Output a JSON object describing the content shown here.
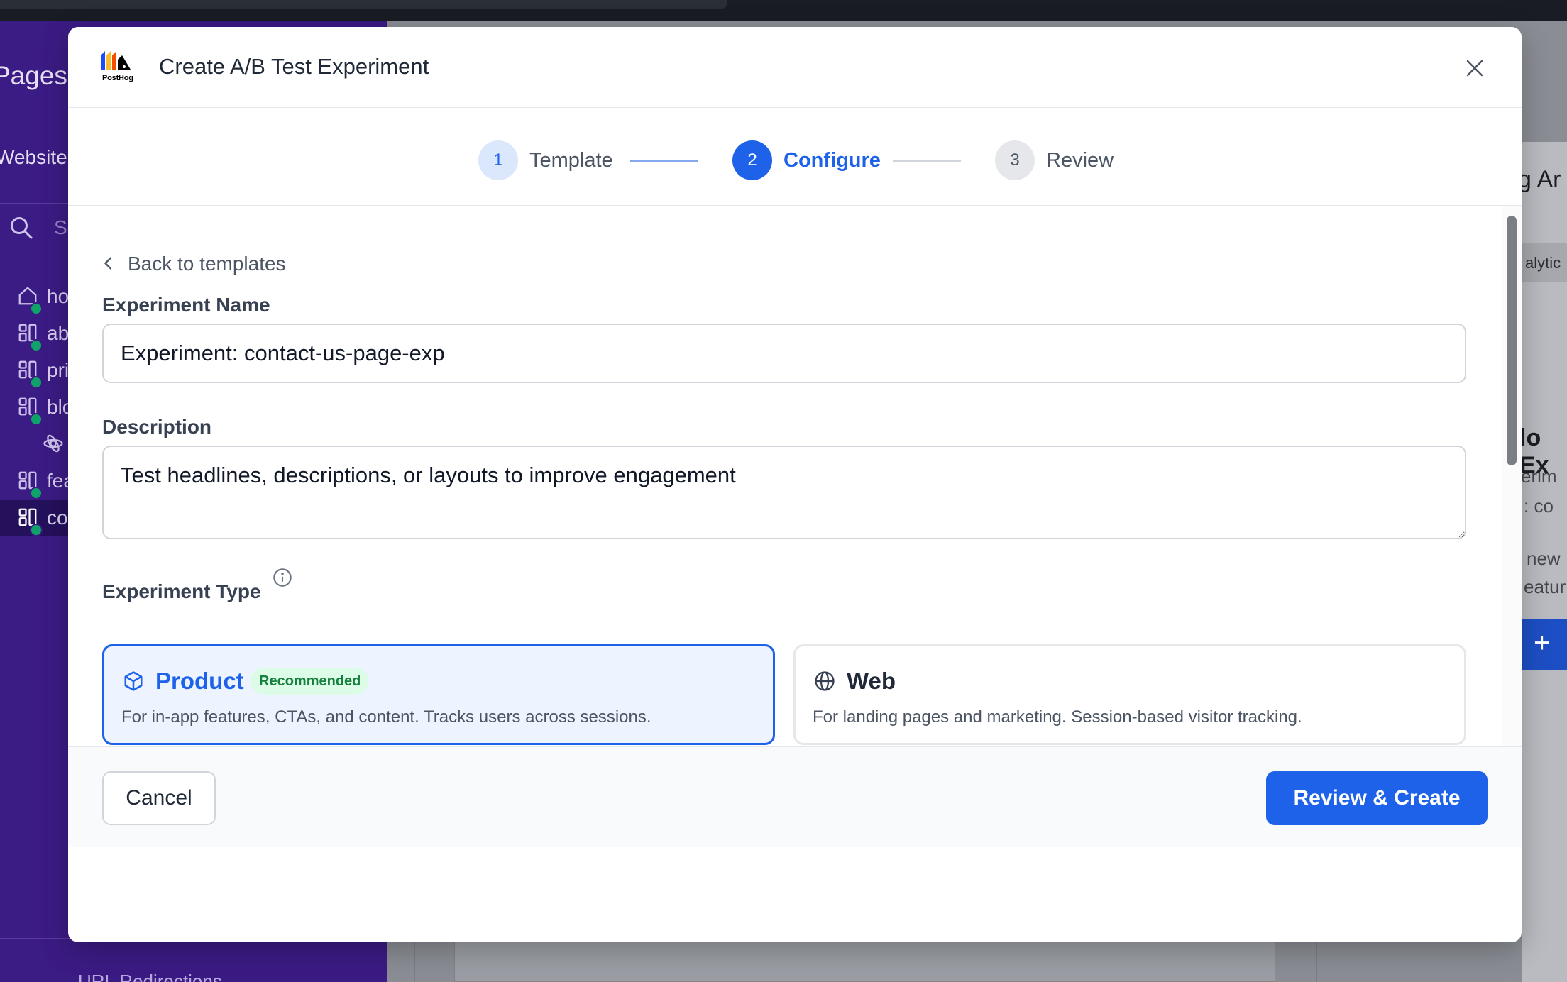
{
  "background": {
    "sidebar": {
      "title": "Pages",
      "subtitle": "Website",
      "search_placeholder": "Se",
      "items": [
        {
          "label": "ho",
          "icon": "home-icon"
        },
        {
          "label": "ab",
          "icon": "layout-icon"
        },
        {
          "label": "pri",
          "icon": "layout-icon"
        },
        {
          "label": "blo",
          "icon": "layout-icon"
        },
        {
          "label": "",
          "icon": "component-icon"
        },
        {
          "label": "fea",
          "icon": "layout-icon"
        },
        {
          "label": "co",
          "icon": "layout-icon"
        }
      ],
      "footer_link": "URL Redirections"
    },
    "right_panel": {
      "heading": "g Ar",
      "chip": "alytic",
      "empty_title": "lo Ex",
      "line1": "erim",
      "line2": ": co",
      "line3": "new",
      "line4": "eatur",
      "button": "+"
    }
  },
  "modal": {
    "logo_text": "PostHog",
    "title": "Create A/B Test Experiment",
    "steps": [
      {
        "number": "1",
        "label": "Template",
        "state": "completed"
      },
      {
        "number": "2",
        "label": "Configure",
        "state": "active"
      },
      {
        "number": "3",
        "label": "Review",
        "state": "upcoming"
      }
    ],
    "back_link": "Back to templates",
    "name_field": {
      "label": "Experiment Name",
      "value": "Experiment: contact-us-page-exp"
    },
    "description_field": {
      "label": "Description",
      "value": "Test headlines, descriptions, or layouts to improve engagement"
    },
    "type_section": {
      "label": "Experiment Type",
      "options": [
        {
          "name": "Product",
          "badge": "Recommended",
          "description": "For in-app features, CTAs, and content. Tracks users across sessions.",
          "icon": "cube-icon",
          "selected": true
        },
        {
          "name": "Web",
          "badge": "",
          "description": "For landing pages and marketing. Session-based visitor tracking.",
          "icon": "globe-icon",
          "selected": false
        }
      ]
    },
    "footer": {
      "cancel_label": "Cancel",
      "primary_label": "Review & Create"
    }
  },
  "colors": {
    "primary": "#1d62e8",
    "sidebar_bg": "#3b1b84",
    "badge_bg": "#dcfce7",
    "badge_text": "#15803d"
  }
}
